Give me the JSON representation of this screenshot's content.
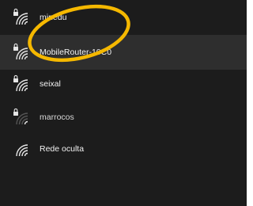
{
  "networks": [
    {
      "name": "minedu",
      "icon": "wifi-secured-icon",
      "signal_bars": 3,
      "secured": true
    },
    {
      "name": "MobileRouter-10C0",
      "icon": "wifi-secured-icon",
      "signal_bars": 4,
      "secured": true,
      "selected": true
    },
    {
      "name": "seixal",
      "icon": "wifi-secured-icon",
      "signal_bars": 3,
      "secured": true
    },
    {
      "name": "marrocos",
      "icon": "wifi-secured-icon",
      "signal_bars": 1,
      "secured": true
    },
    {
      "name": "Rede oculta",
      "icon": "wifi-icon",
      "signal_bars": 3,
      "secured": false
    }
  ],
  "colors": {
    "panel_background": "#1c1c1c",
    "selected_row": "#2e2e2e",
    "text": "#f2f2f2",
    "annotation_circle": "#f5b800"
  }
}
